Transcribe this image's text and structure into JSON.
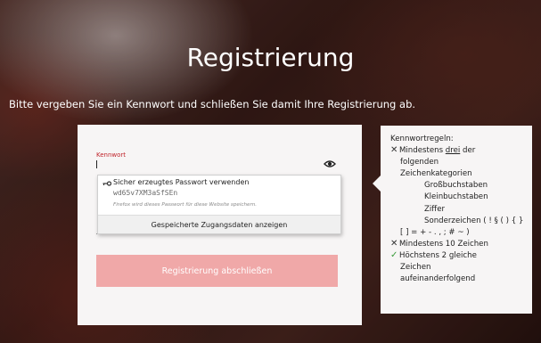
{
  "page": {
    "title": "Registrierung",
    "subtitle": "Bitte vergeben Sie ein Kennwort und schließen Sie damit Ihre Registrierung ab."
  },
  "form": {
    "password_label": "Kennwort",
    "submit_label": "Registrierung abschließen",
    "colors": {
      "accent": "#c8282c",
      "submit_disabled": "#f0a8a8"
    }
  },
  "autofill": {
    "title": "Sicher erzeugtes Passwort verwenden",
    "password": "wd65v7XM3aSfSEn",
    "note": "Firefox wird dieses Passwort für diese Website speichern.",
    "show_saved_label": "Gespeicherte Zugangsdaten anzeigen"
  },
  "rules": {
    "heading": "Kennwortregeln:",
    "rule1_prefix": "Mindestens ",
    "rule1_emph": "drei",
    "rule1_suffix": " der",
    "rule1_line2": "folgenden",
    "rule1_line3": "Zeichenkategorien",
    "categories": [
      "Großbuchstaben",
      "Kleinbuchstaben",
      "Ziffer"
    ],
    "special_line1": "Sonderzeichen ( ! § ( ) { }",
    "special_line2": "[ ] = + - . , ; # ~ )",
    "rule2": "Mindestens 10 Zeichen",
    "rule3_line1": "Höchstens 2 gleiche",
    "rule3_line2": "Zeichen",
    "rule3_line3": "aufeinanderfolgend",
    "statuses": [
      "failed",
      "failed",
      "passed"
    ]
  }
}
